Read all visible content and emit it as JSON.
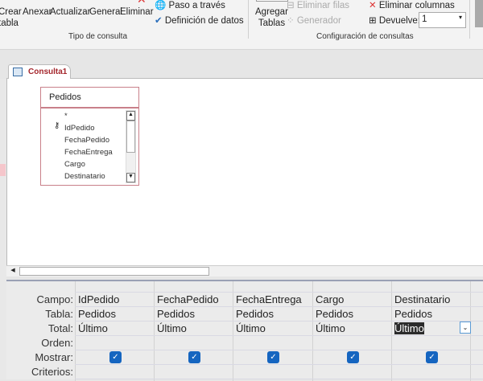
{
  "ribbon": {
    "buttons": [
      "Crear tabla",
      "Anexar",
      "Actualizar",
      "General",
      "Eliminar"
    ],
    "crear": "Crear",
    "tabla": "tabla",
    "paso": "Paso a través",
    "definicion": "Definición de datos",
    "tipo_group": "Tipo de consulta",
    "agregar": "Agregar",
    "tablas": "Tablas",
    "eliminar_filas": "Eliminar filas",
    "generador": "Generador",
    "eliminar_columnas": "Eliminar columnas",
    "devuelve": "Devuelve:",
    "devuelve_value": "1",
    "config_group": "Configuración de consultas"
  },
  "tab": {
    "label": "Consulta1"
  },
  "table_box": {
    "title": "Pedidos",
    "fields": [
      "*",
      "IdPedido",
      "FechaPedido",
      "FechaEntrega",
      "Cargo",
      "Destinatario"
    ]
  },
  "grid": {
    "row_labels": [
      "Campo:",
      "Tabla:",
      "Total:",
      "Orden:",
      "Mostrar:",
      "Criterios:"
    ],
    "columns": [
      {
        "campo": "IdPedido",
        "tabla": "Pedidos",
        "total": "Último",
        "mostrar": true
      },
      {
        "campo": "FechaPedido",
        "tabla": "Pedidos",
        "total": "Último",
        "mostrar": true
      },
      {
        "campo": "FechaEntrega",
        "tabla": "Pedidos",
        "total": "Último",
        "mostrar": true
      },
      {
        "campo": "Cargo",
        "tabla": "Pedidos",
        "total": "Último",
        "mostrar": true
      },
      {
        "campo": "Destinatario",
        "tabla": "Pedidos",
        "total": "Último",
        "mostrar": true
      }
    ]
  },
  "colors": {
    "accent": "#a4262c",
    "check": "#1565c0"
  }
}
